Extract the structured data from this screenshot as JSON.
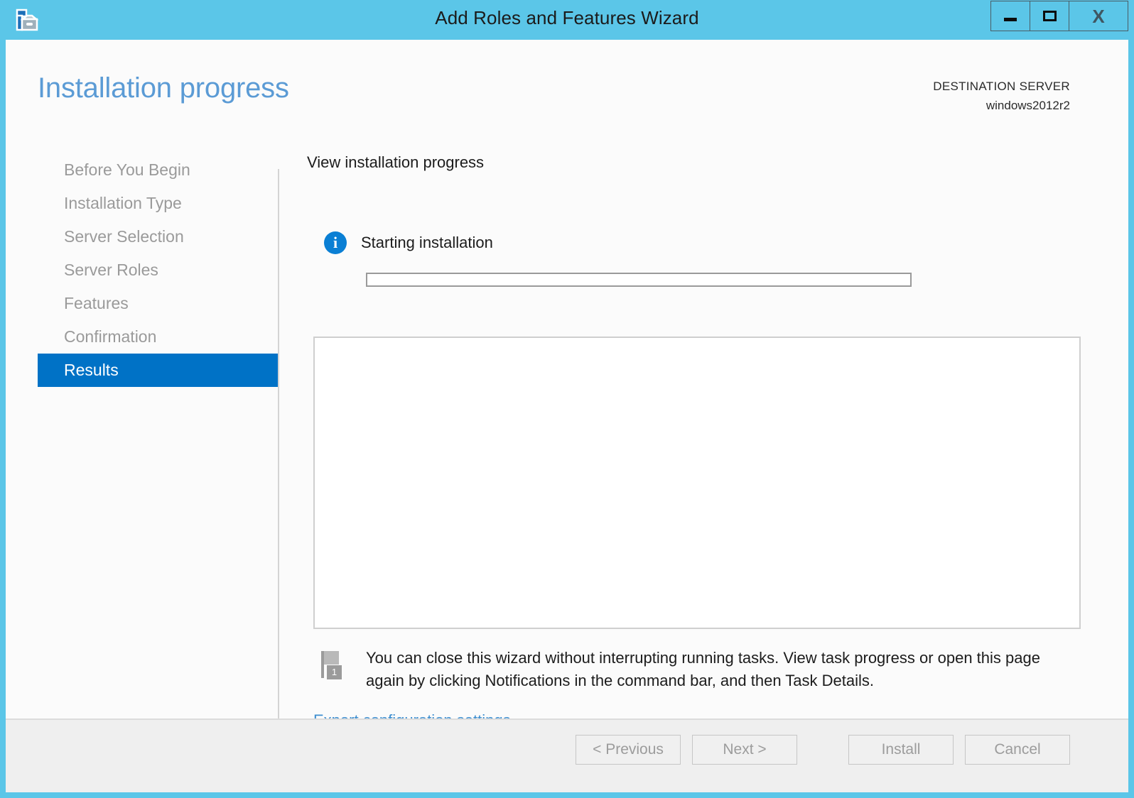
{
  "window": {
    "title": "Add Roles and Features Wizard",
    "app_icon": "wizard-toolbox-icon",
    "controls": {
      "minimize": "minimize-icon",
      "maximize": "maximize-icon",
      "close": "X"
    },
    "colors": {
      "frame": "#5BC6E8",
      "accent": "#0072C6",
      "body": "#FBFBFB",
      "footer": "#EFEFEF",
      "link": "#3F8FD0",
      "title_heading": "#5B9BD5"
    }
  },
  "header": {
    "page_title": "Installation progress",
    "destination_label": "DESTINATION SERVER",
    "destination_value": "windows2012r2"
  },
  "sidebar": {
    "items": [
      {
        "label": "Before You Begin",
        "selected": false
      },
      {
        "label": "Installation Type",
        "selected": false
      },
      {
        "label": "Server Selection",
        "selected": false
      },
      {
        "label": "Server Roles",
        "selected": false
      },
      {
        "label": "Features",
        "selected": false
      },
      {
        "label": "Confirmation",
        "selected": false
      },
      {
        "label": "Results",
        "selected": true
      }
    ]
  },
  "main": {
    "section_heading": "View installation progress",
    "status": {
      "icon": "info-icon",
      "text": "Starting installation"
    },
    "progress": {
      "percent": 0,
      "percent_label": "0%"
    },
    "results_box": {
      "content": ""
    },
    "notification": {
      "icon": "flag-icon",
      "badge_count": "1",
      "text": "You can close this wizard without interrupting running tasks. View task progress or open this page again by clicking Notifications in the command bar, and then Task Details."
    },
    "export_link": "Export configuration settings"
  },
  "footer": {
    "buttons": [
      {
        "label": "< Previous",
        "disabled": true
      },
      {
        "label": "Next >",
        "disabled": true
      },
      {
        "label": "Install",
        "disabled": true
      },
      {
        "label": "Cancel",
        "disabled": true
      }
    ]
  }
}
